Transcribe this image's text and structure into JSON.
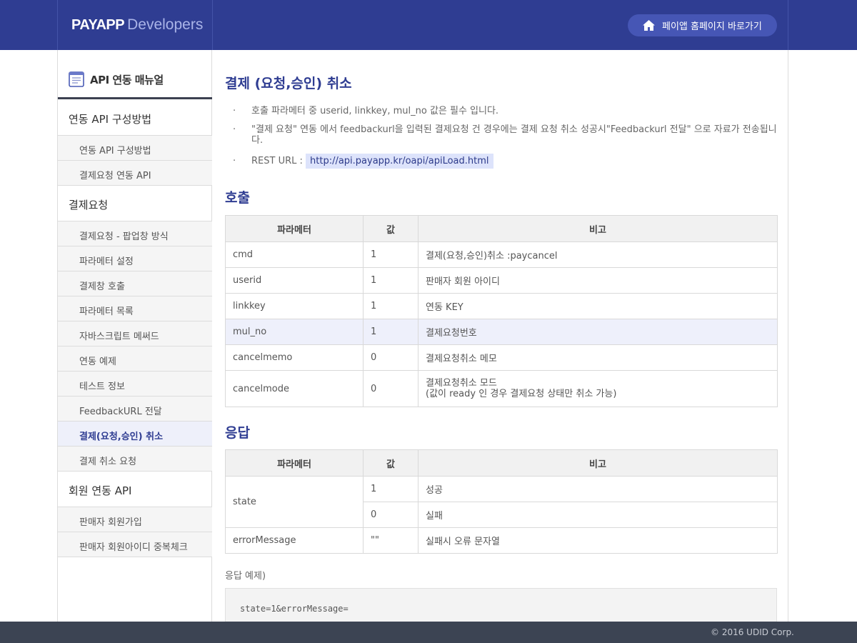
{
  "header": {
    "brand_bold": "PAYAPP",
    "brand_light": "Developers",
    "home_label": "페이앱 홈페이지 바로가기"
  },
  "sidebar": {
    "title": "API 연동 매뉴얼",
    "categories": [
      {
        "label": "연동 API 구성방법",
        "items": [
          "연동 API 구성방법",
          "결제요청 연동 API"
        ]
      },
      {
        "label": "결제요청",
        "items": [
          "결제요청 - 팝업창 방식",
          "파라메터 설정",
          "결제창 호출",
          "파라메터 목록",
          "자바스크립트 메써드",
          "연동 예제",
          "테스트 정보",
          "FeedbackURL 전달",
          "결제(요청,승인) 취소",
          "결제 취소 요청"
        ]
      },
      {
        "label": "회원 연동 API",
        "items": [
          "판매자 회원가입",
          "판매자 회원아이디 중복체크"
        ]
      }
    ],
    "active_item": "결제(요청,승인) 취소"
  },
  "main": {
    "title": "결제 (요청,승인) 취소",
    "bullet_mark": "·",
    "bullets": [
      "호출 파라메터 중 userid, linkkey, mul_no 값은 필수 입니다.",
      "\"결제 요청\" 연동 에서 feedbackurl을 입력된 결제요청 건 경우에는 결제 요청 취소 성공시\"Feedbackurl 전달\" 으로 자료가 전송됩니다."
    ],
    "rest_label": "REST URL :",
    "rest_url": "http://api.payapp.kr/oapi/apiLoad.html",
    "call_title": "호출",
    "call_table": {
      "headers": [
        "파라메터",
        "값",
        "비고"
      ],
      "rows": [
        [
          "cmd",
          "1",
          "결제(요청,승인)취소 :paycancel"
        ],
        [
          "userid",
          "1",
          "판매자 회원 아이디"
        ],
        [
          "linkkey",
          "1",
          "연동 KEY"
        ],
        [
          "mul_no",
          "1",
          "결제요청번호"
        ],
        [
          "cancelmemo",
          "0",
          "결제요청취소 메모"
        ],
        [
          "cancelmode",
          "0",
          "결제요청취소 모드"
        ]
      ],
      "cancelmode_note": "(값이 ready 인 경우 결제요청 상태만 취소 가능)"
    },
    "resp_title": "응답",
    "resp_table": {
      "headers": [
        "파라메터",
        "값",
        "비고"
      ],
      "state": "state",
      "state_rows": [
        [
          "1",
          "성공"
        ],
        [
          "0",
          "실패"
        ]
      ],
      "error_row": [
        "errorMessage",
        "\"\"",
        "실패시 오류 문자열"
      ]
    },
    "example_label": "응답 예제)",
    "example_code": "state=1&errorMessage="
  },
  "footer": {
    "copyright": "© 2016 UDID Corp."
  },
  "colors": {
    "header_bg": "#2f3d92",
    "accent": "#2f3d92",
    "footer_bg": "#3c4453",
    "highlight_row": "#eef0fb"
  }
}
